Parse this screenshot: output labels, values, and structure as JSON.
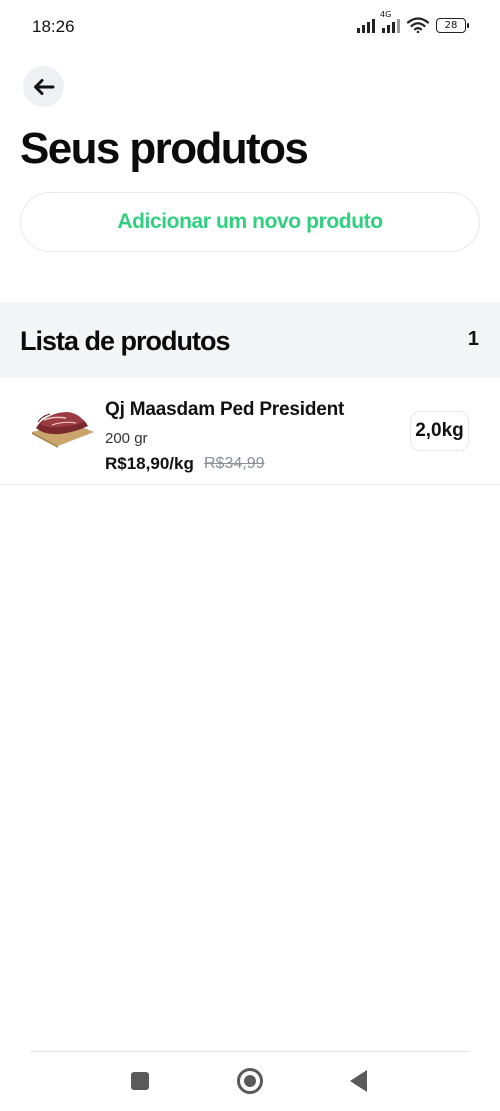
{
  "status_bar": {
    "time": "18:26",
    "network_type": "4G",
    "battery_level": "28",
    "icons": [
      "signal-icon",
      "signal-4g-icon",
      "wifi-icon",
      "battery-icon"
    ]
  },
  "header": {
    "back_icon": "arrow-left-icon",
    "title": "Seus produtos"
  },
  "actions": {
    "add_product_label": "Adicionar um novo produto",
    "accent_color": "#2fd07f"
  },
  "product_list": {
    "title": "Lista de produtos",
    "count": "1",
    "items": [
      {
        "name": "Qj Maasdam Ped President",
        "weight": "200 gr",
        "price": "R$18,90/kg",
        "old_price": "R$34,99",
        "quantity": "2,0kg",
        "image_icon": "meat-product-image"
      }
    ]
  },
  "nav_bar": {
    "icons": [
      "recent-apps-icon",
      "home-icon",
      "back-triangle-icon"
    ]
  }
}
